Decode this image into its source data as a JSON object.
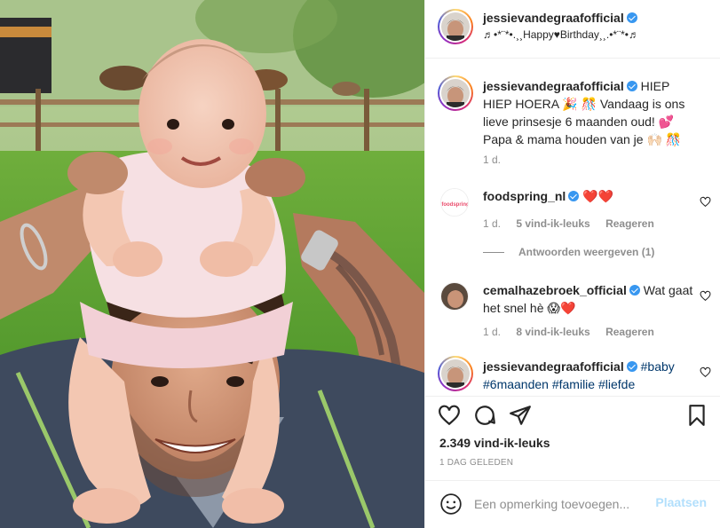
{
  "post": {
    "author": "jessievandegraafofficial",
    "location": "♬•*¨*•.¸¸Happy♥Birthday¸¸.•*¨*•♬",
    "photo_alt_subject": "father-with-baby-on-shoulders"
  },
  "caption": {
    "username": "jessievandegraafofficial",
    "text": "HIEP HIEP HOERA 🎉 🎊 Vandaag is ons lieve prinsesje 6 maanden oud! 💕 Papa & mama houden van je 🙌🏻 🎊",
    "time": "1 d."
  },
  "comments": [
    {
      "username": "foodspring_nl",
      "text": "❤️❤️",
      "time": "1 d.",
      "likes": "5 vind-ik-leuks",
      "reply": "Reageren",
      "view_replies": "Antwoorden weergeven (1)",
      "avatar_text": "foodspring"
    },
    {
      "username": "cemalhazebroek_official",
      "text": "Wat gaat het snel hè 😱❤️",
      "time": "1 d.",
      "likes": "8 vind-ik-leuks",
      "reply": "Reageren"
    },
    {
      "username": "jessievandegraafofficial",
      "text": "#baby #6maanden #familie #liefde"
    }
  ],
  "actions": {
    "likes": "2.349 vind-ik-leuks",
    "date": "1 DAG GELEDEN"
  },
  "add_comment": {
    "placeholder": "Een opmerking toevoegen...",
    "submit": "Plaatsen"
  },
  "colors": {
    "link": "#00376b",
    "verified": "#3897f0",
    "muted": "#8e8e8e",
    "post_button": "#b2dffc",
    "heart": "#ed4956"
  }
}
